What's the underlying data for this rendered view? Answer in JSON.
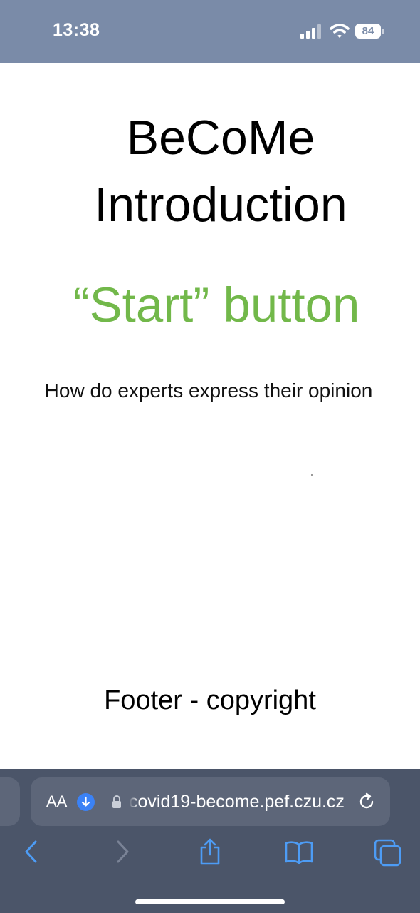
{
  "status_bar": {
    "time": "13:38",
    "battery": "84"
  },
  "page": {
    "title": "BeCoMe Introduction",
    "start_label": "“Start” button",
    "subtitle": "How do experts express their opinion",
    "footer": "Footer - copyright"
  },
  "browser": {
    "text_size_label": "AA",
    "url": "covid19-become.pef.czu.cz"
  },
  "colors": {
    "status_bar_bg": "#7a8ba8",
    "start_label_green": "#72b84a",
    "toolbar_bg": "#4b5569",
    "accent_blue": "#3b82f6"
  },
  "icons": [
    "signal-icon",
    "wifi-icon",
    "battery-icon",
    "download-icon",
    "lock-icon",
    "reload-icon",
    "back-icon",
    "forward-icon",
    "share-icon",
    "bookmarks-icon",
    "tabs-icon"
  ]
}
